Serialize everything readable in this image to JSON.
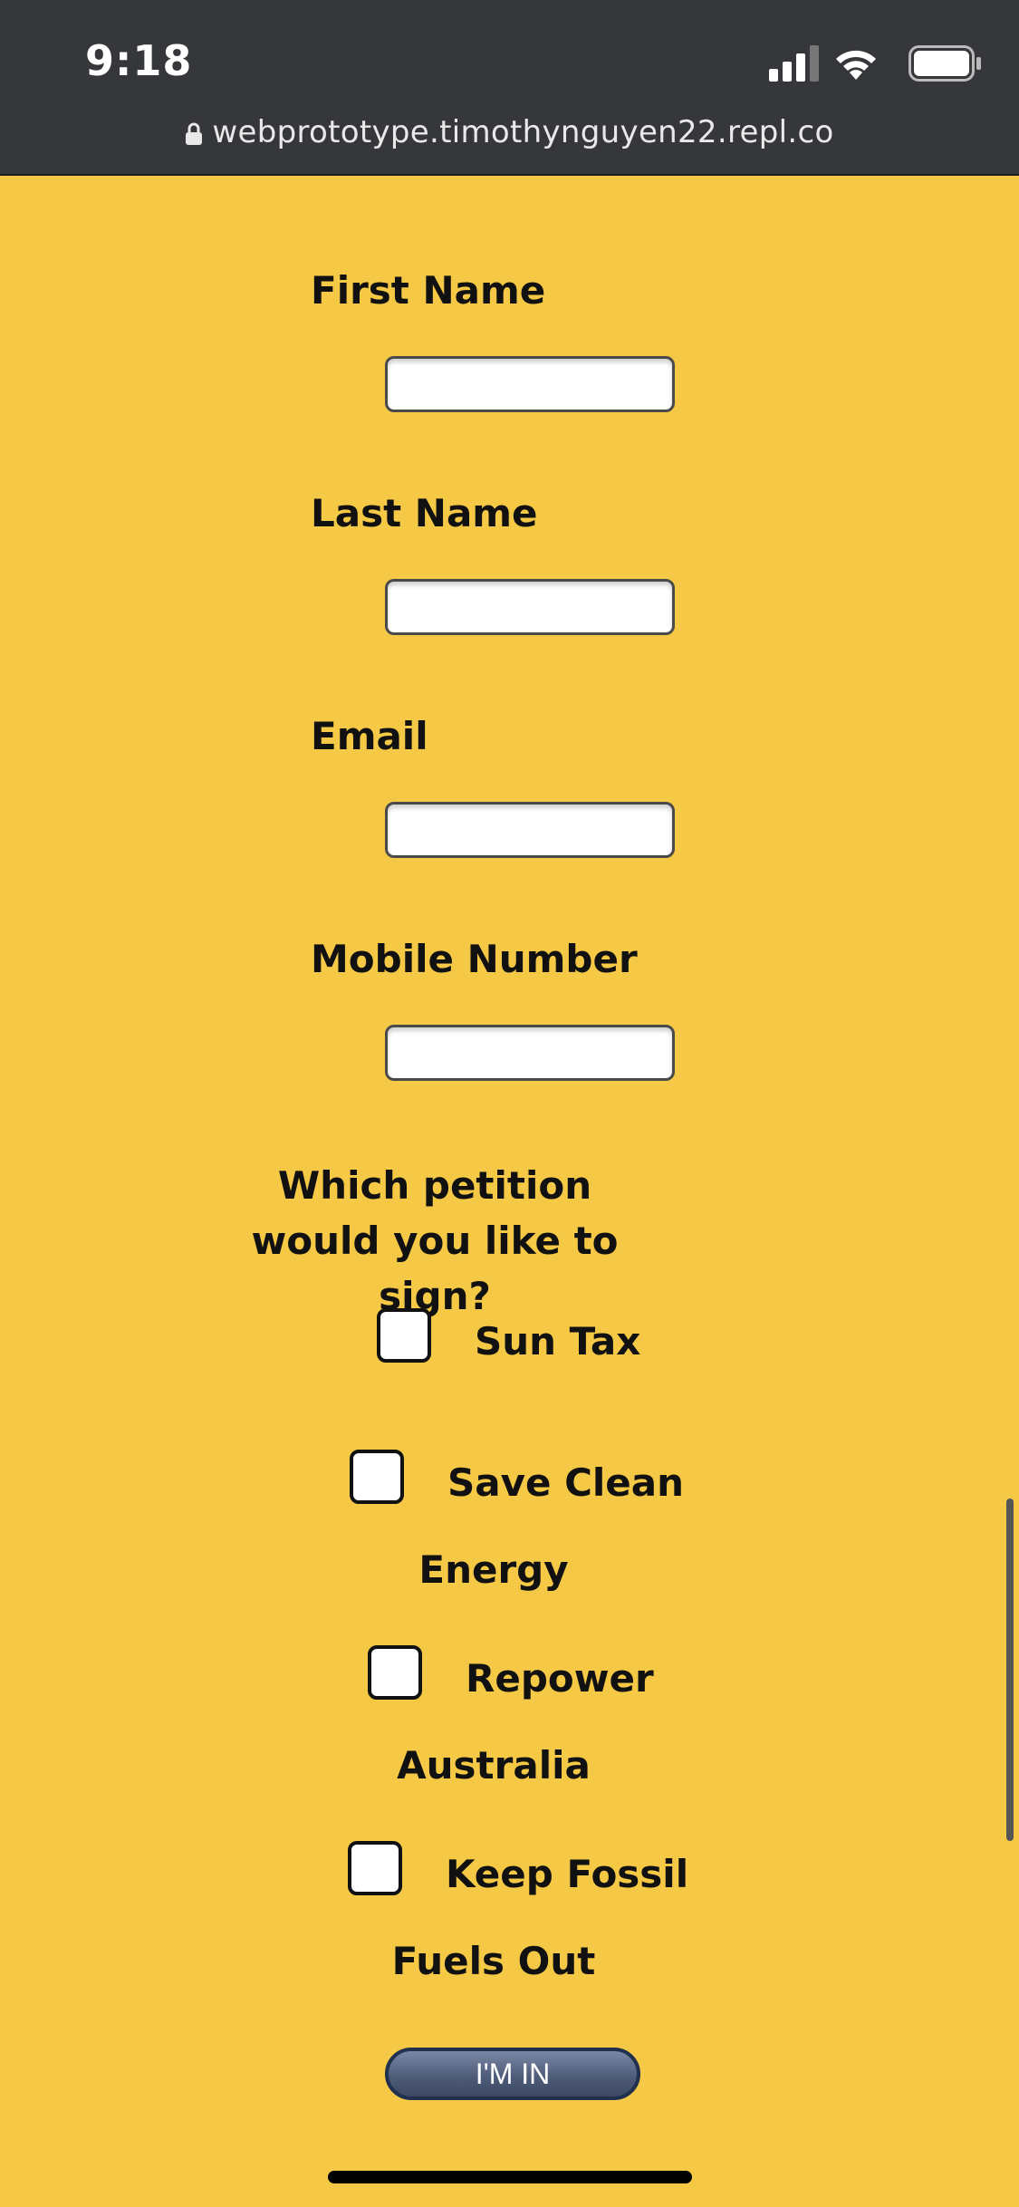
{
  "status_bar": {
    "time": "9:18",
    "url": "webprototype.timothynguyen22.repl.co"
  },
  "form": {
    "first_name_label": "First Name",
    "last_name_label": "Last Name",
    "email_label": "Email",
    "mobile_label": "Mobile Number",
    "question_line1": "Which petition",
    "question_line2": "would you like to sign?",
    "options": [
      {
        "line1": "Sun Tax",
        "line2": ""
      },
      {
        "line1": "Save Clean",
        "line2": "Energy"
      },
      {
        "line1": "Repower",
        "line2": "Australia"
      },
      {
        "line1": "Keep Fossil",
        "line2": "Fuels Out"
      }
    ],
    "submit_label": "I'M IN"
  },
  "colors": {
    "background": "#F5C946",
    "status_bar": "#36373A",
    "button": "#4f5d7a"
  }
}
